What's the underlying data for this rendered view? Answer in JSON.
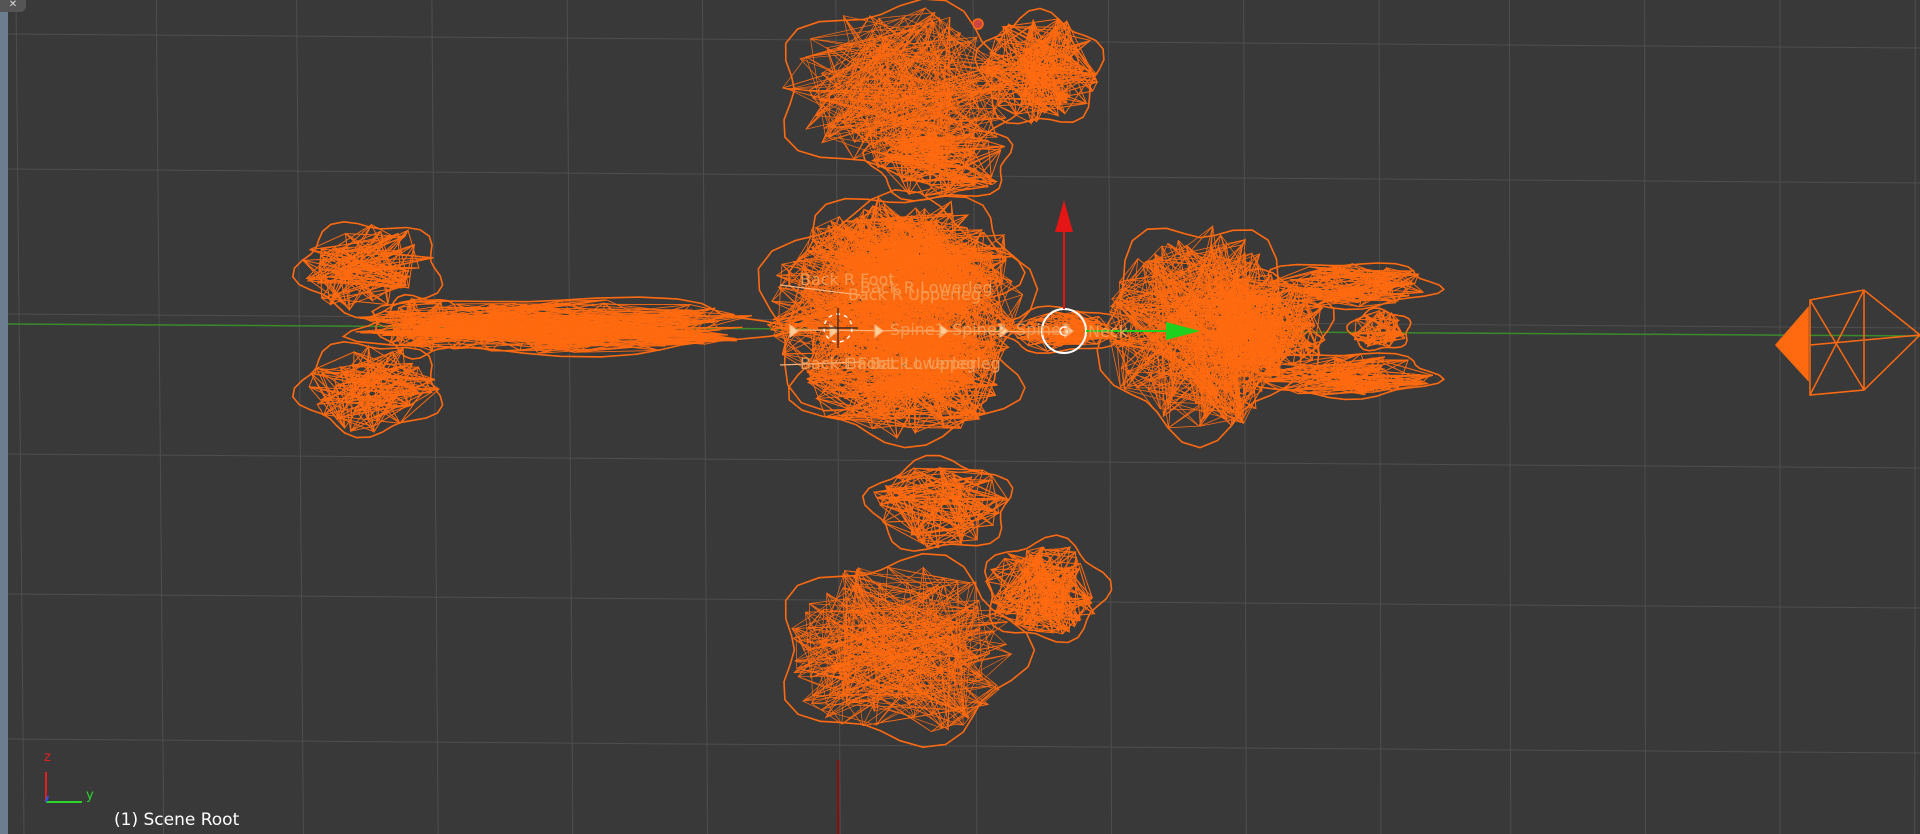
{
  "viewport": {
    "background": "#393939",
    "grid_color": "#4e4e4e",
    "x_axis_color": "#3a8a2a",
    "wire_color": "#ff6a10",
    "scene_label": "(1) Scene Root",
    "corner_icon": "close-icon"
  },
  "bones": [
    {
      "label": "Back R Foot"
    },
    {
      "label": "Back R Lowerleg"
    },
    {
      "label": "Back R Upperleg"
    },
    {
      "label": "Spine1"
    },
    {
      "label": "Spine2"
    },
    {
      "label": "Spine3"
    },
    {
      "label": "Neck"
    },
    {
      "label": "Back L Foot"
    },
    {
      "label": "Back L Lowerleg"
    },
    {
      "label": "Back L Upperleg"
    }
  ],
  "gizmo": {
    "y_arrow_color": "#1fd01f",
    "z_arrow_color": "#e31515",
    "ring_color": "#ffffff"
  },
  "axes": {
    "z_label": "z",
    "y_label": "y",
    "z_color": "#e32020",
    "y_color": "#2ad62a",
    "x_color": "#2a55e3"
  },
  "camera": {
    "icon": "camera-icon"
  }
}
